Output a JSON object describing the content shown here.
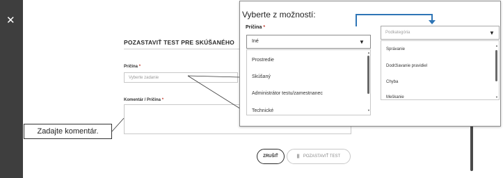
{
  "window": {
    "close_glyph": "✕"
  },
  "modal": {
    "title": "POZASTAVIŤ TEST PRE SKÚŠANÉHO",
    "reason_label": "Príčina",
    "required_mark": "*",
    "reason_placeholder": "Vyberte zadanie",
    "comment_label": "Komentár / Príčina",
    "cancel_label": "ZRUŠIŤ",
    "pause_label": "POZASTAVIŤ TEST",
    "pause_glyph": "||"
  },
  "callout": {
    "text": "Zadajte komentár."
  },
  "options_panel": {
    "title": "Vyberte z možností:",
    "reason_label": "Príčina",
    "reason_selected": "Iné",
    "reason_options": [
      "Prostredie",
      "Skúšaný",
      "Administrátor testu/zamestnanec",
      "Technické"
    ],
    "subcategory_placeholder": "Podkategória",
    "subcategory_options": [
      "Správanie",
      "Dodržiavanie pravidiel",
      "Chyba",
      "Meškanie"
    ]
  },
  "colors": {
    "side_strip": "#3e3e3e",
    "accent_arrow": "#2e75b6",
    "required": "#c0392b"
  },
  "icons": {
    "close": "close-icon",
    "dropdown": "chevron-down-icon",
    "pause": "pause-icon",
    "arrow": "connector-arrow-icon"
  }
}
